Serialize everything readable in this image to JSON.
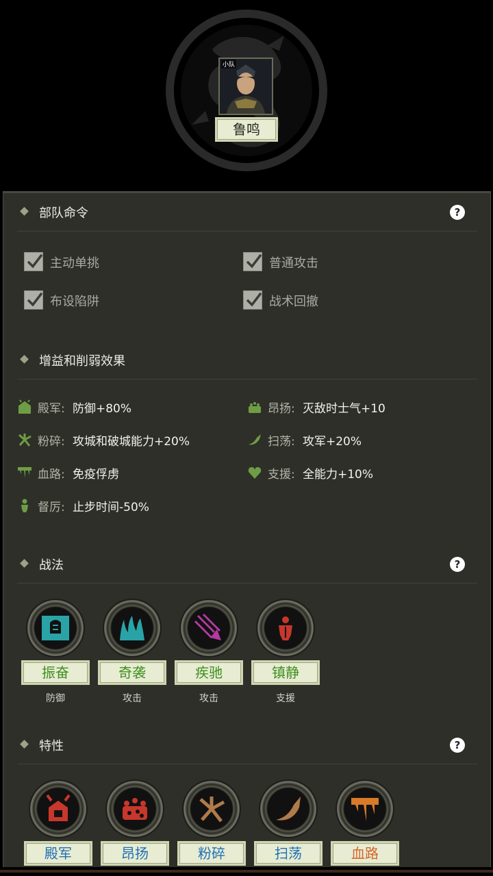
{
  "header": {
    "squad_tag": "小队",
    "general_name": "鲁鸣"
  },
  "commands": {
    "title": "部队命令",
    "help": "?",
    "items": [
      {
        "label": "主动单挑",
        "checked": true
      },
      {
        "label": "普通攻击",
        "checked": true
      },
      {
        "label": "布设陷阱",
        "checked": true
      },
      {
        "label": "战术回撤",
        "checked": true
      }
    ]
  },
  "buffs": {
    "title": "增益和削弱效果",
    "items": [
      {
        "name": "殿军:",
        "value": "防御+80%",
        "icon": "rearguard-icon"
      },
      {
        "name": "昂扬:",
        "value": "灭敌时士气+10",
        "icon": "morale-icon"
      },
      {
        "name": "粉碎:",
        "value": "攻城和破城能力+20%",
        "icon": "shatter-icon"
      },
      {
        "name": "扫荡:",
        "value": "攻军+20%",
        "icon": "sweep-icon"
      },
      {
        "name": "血路:",
        "value": "免疫俘虏",
        "icon": "blood-path-icon"
      },
      {
        "name": "支援:",
        "value": "全能力+10%",
        "icon": "support-icon"
      },
      {
        "name": "督厉:",
        "value": "止步时间-50%",
        "icon": "supervise-icon"
      }
    ]
  },
  "tactics": {
    "title": "战法",
    "help": "?",
    "items": [
      {
        "label": "振奋",
        "type": "防御",
        "icon": "rally-icon"
      },
      {
        "label": "奇袭",
        "type": "攻击",
        "icon": "raid-icon"
      },
      {
        "label": "疾驰",
        "type": "攻击",
        "icon": "charge-icon"
      },
      {
        "label": "镇静",
        "type": "支援",
        "icon": "calm-icon"
      }
    ]
  },
  "traits": {
    "title": "特性",
    "help": "?",
    "items": [
      {
        "label": "殿军",
        "icon": "rearguard-trait-icon"
      },
      {
        "label": "昂扬",
        "icon": "morale-trait-icon"
      },
      {
        "label": "粉碎",
        "icon": "shatter-trait-icon"
      },
      {
        "label": "扫荡",
        "icon": "sweep-trait-icon"
      },
      {
        "label": "血路",
        "icon": "blood-path-trait-icon"
      }
    ]
  },
  "colors": {
    "panel_bg": "#2e2f29",
    "tactic_label": "#3f8f1e",
    "trait_label": "#1f6fb5",
    "trait_label_alt": "#d6642a",
    "buff_icon": "#7dbb4a"
  }
}
